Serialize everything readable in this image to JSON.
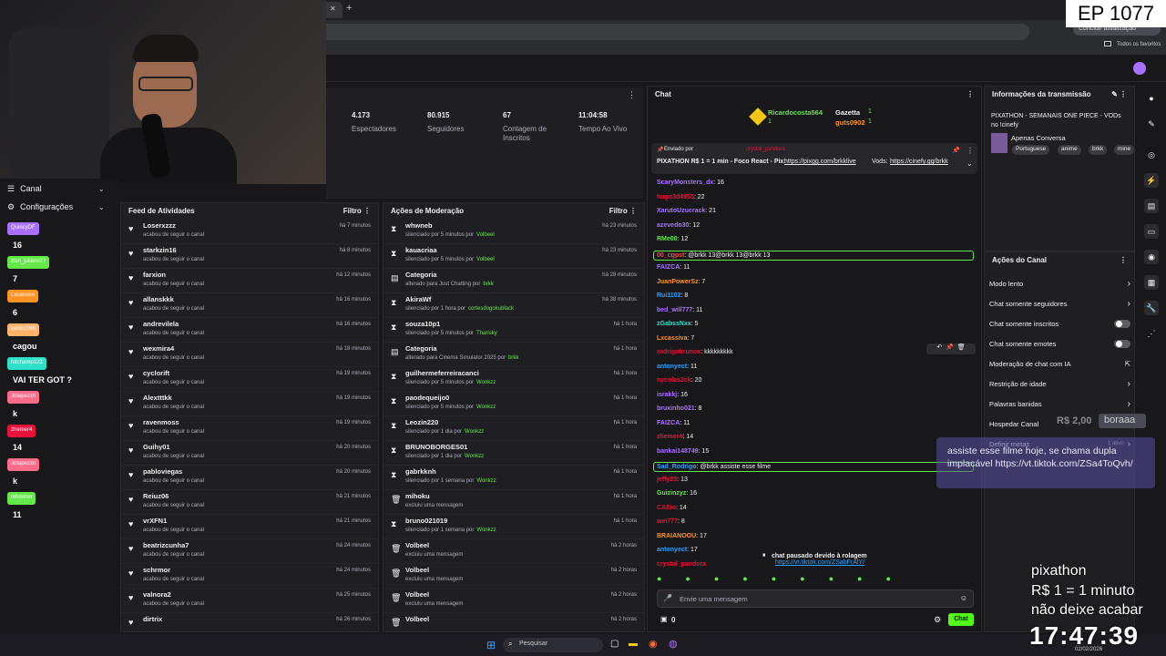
{
  "browser": {
    "add_tab": "+",
    "close_tab": "✕",
    "update_chip": "Concluir atualização",
    "favorites": "Todos os favoritos"
  },
  "ep_badge": "EP 1077",
  "sidebar": {
    "canal": "Canal",
    "configuracoes": "Configurações",
    "viewers": [
      {
        "name": "QuincyDF",
        "value": "16",
        "color": "#a970ff"
      },
      {
        "name": "zion_juliano17",
        "value": "7",
        "color": "#65e84a"
      },
      {
        "name": "Lxcassiva",
        "value": "6",
        "color": "#ff9326"
      },
      {
        "name": "kaiobz069",
        "value": "cagou",
        "color": "#ffb36b"
      },
      {
        "name": "futchamp123",
        "value": "VAI TER GOT ?",
        "color": "#2fe0c8"
      },
      {
        "name": "Jotapezzn",
        "value": "k",
        "color": "#ff6b8b"
      },
      {
        "name": "zhemer4",
        "value": "14",
        "color": "#e8113b"
      },
      {
        "name": "Jotapezzn",
        "value": "k",
        "color": "#ff6b8b"
      },
      {
        "name": "mhmmm",
        "value": "11",
        "color": "#65e84a"
      }
    ]
  },
  "stats": [
    {
      "num": "4.173",
      "label": "Espectadores"
    },
    {
      "num": "80.915",
      "label": "Seguidores"
    },
    {
      "num": "67",
      "label": "Contagem de Inscritos"
    },
    {
      "num": "11:04:58",
      "label": "Tempo Ao Vivo"
    }
  ],
  "feed": {
    "title": "Feed de Atividades",
    "filter": "Filtro",
    "items": [
      {
        "name": "Loserxzzz",
        "desc": "acabou de seguir o canal",
        "time": "há 7 minutos"
      },
      {
        "name": "starkzin16",
        "desc": "acabou de seguir o canal",
        "time": "há 8 minutos"
      },
      {
        "name": "farxion",
        "desc": "acabou de seguir o canal",
        "time": "há 12 minutos"
      },
      {
        "name": "allanskkk",
        "desc": "acabou de seguir o canal",
        "time": "há 16 minutos"
      },
      {
        "name": "andrevilela",
        "desc": "acabou de seguir o canal",
        "time": "há 16 minutos"
      },
      {
        "name": "wexmira4",
        "desc": "acabou de seguir o canal",
        "time": "há 18 minutos"
      },
      {
        "name": "cyclorift",
        "desc": "acabou de seguir o canal",
        "time": "há 19 minutos"
      },
      {
        "name": "Alextttkk",
        "desc": "acabou de seguir o canal",
        "time": "há 19 minutos"
      },
      {
        "name": "ravenmoss",
        "desc": "acabou de seguir o canal",
        "time": "há 19 minutos"
      },
      {
        "name": "Guihy01",
        "desc": "acabou de seguir o canal",
        "time": "há 20 minutos"
      },
      {
        "name": "pabloviegas",
        "desc": "acabou de seguir o canal",
        "time": "há 20 minutos"
      },
      {
        "name": "Reiuz06",
        "desc": "acabou de seguir o canal",
        "time": "há 21 minutos"
      },
      {
        "name": "vrXFN1",
        "desc": "acabou de seguir o canal",
        "time": "há 21 minutos"
      },
      {
        "name": "beatrizcunha7",
        "desc": "acabou de seguir o canal",
        "time": "há 24 minutos"
      },
      {
        "name": "schrmor",
        "desc": "acabou de seguir o canal",
        "time": "há 24 minutos"
      },
      {
        "name": "valnora2",
        "desc": "acabou de seguir o canal",
        "time": "há 25 minutos"
      },
      {
        "name": "dirtrix",
        "desc": "",
        "time": "há 26 minutos"
      }
    ]
  },
  "moderation": {
    "title": "Ações de Moderação",
    "filter": "Filtro",
    "items": [
      {
        "icon": "⧗",
        "name": "whwneb",
        "desc": "silenciado por 5 minutos por",
        "by": "Volbeel",
        "time": "há 23 minutos"
      },
      {
        "icon": "⧗",
        "name": "kauacriaa",
        "desc": "silenciado por 5 minutos por",
        "by": "Volbeel",
        "time": "há 23 minutos"
      },
      {
        "icon": "▤",
        "name": "Categoria",
        "desc": "alterado para Just Chatting por",
        "by": "brkk",
        "time": "há 28 minutos"
      },
      {
        "icon": "⧗",
        "name": "AkiraWf",
        "desc": "silenciado por 1 hora por",
        "by": "cortesdogokublack",
        "time": "há 38 minutos"
      },
      {
        "icon": "⧗",
        "name": "souza10p1",
        "desc": "silenciado por 5 minutos por",
        "by": "Tharisky",
        "time": "há 1 hora"
      },
      {
        "icon": "▤",
        "name": "Categoria",
        "desc": "alterado para Cinema Simulator 2025 por",
        "by": "brkk",
        "time": "há 1 hora"
      },
      {
        "icon": "⧗",
        "name": "guilhermeferreiracanci",
        "desc": "silenciado por 5 minutos por",
        "by": "Wonkzz",
        "time": "há 1 hora"
      },
      {
        "icon": "⧗",
        "name": "paodequeijo0",
        "desc": "silenciado por 5 minutos por",
        "by": "Wonkzz",
        "time": "há 1 hora"
      },
      {
        "icon": "⧗",
        "name": "Leozin220",
        "desc": "silenciado por 1 dia por",
        "by": "Wonkzz",
        "time": "há 1 hora"
      },
      {
        "icon": "⧗",
        "name": "BRUNOBORGES01",
        "desc": "silenciado por 1 dia por",
        "by": "Wonkzz",
        "time": "há 1 hora"
      },
      {
        "icon": "⧗",
        "name": "gabrkknh",
        "desc": "silenciado por 1 semana por",
        "by": "Wonkzz",
        "time": "há 1 hora"
      },
      {
        "icon": "🗑",
        "name": "mihoku",
        "desc": "excluiu uma mensagem",
        "by": "",
        "time": "há 1 hora"
      },
      {
        "icon": "⧗",
        "name": "bruno021019",
        "desc": "silenciado por 1 semana por",
        "by": "Wonkzz",
        "time": "há 1 hora"
      },
      {
        "icon": "🗑",
        "name": "Volbeel",
        "desc": "excluiu uma mensagem",
        "by": "",
        "time": "há 2 horas"
      },
      {
        "icon": "🗑",
        "name": "Volbeel",
        "desc": "excluiu uma mensagem",
        "by": "",
        "time": "há 2 horas"
      },
      {
        "icon": "🗑",
        "name": "Volbeel",
        "desc": "excluiu uma mensagem",
        "by": "",
        "time": "há 2 horas"
      },
      {
        "icon": "🗑",
        "name": "Volbeel",
        "desc": "",
        "by": "",
        "time": "há 2 horas"
      }
    ]
  },
  "chat": {
    "title": "Chat",
    "top_gifters": [
      {
        "name": "Ricardocosta564",
        "count": "1"
      },
      {
        "name": "Gazetta",
        "count": "1"
      },
      {
        "name": "guts0902",
        "count": "1"
      }
    ],
    "pinned_by_label": "Enviado por",
    "pinned_by": "crystal_pandora",
    "pinned_text": "PIXATHON R$ 1 = 1 min - Foco React - Pix:",
    "pinned_link1": "https://pixgg.com/brkklive",
    "pinned_vods": "Vods:",
    "pinned_link2": "https://cinefy.gg/brkk",
    "messages": [
      {
        "user": "ScaryMonsters_dx",
        "color": "#a970ff",
        "text": ": 16"
      },
      {
        "user": "hugo3d4955",
        "color": "#e8113b",
        "text": ": 22"
      },
      {
        "user": "XarutoUzucrack",
        "color": "#a970ff",
        "text": ": 21"
      },
      {
        "user": "azevedo30",
        "color": "#a970ff",
        "text": ": 12"
      },
      {
        "user": "RMe00",
        "color": "#65e84a",
        "text": ": 12"
      },
      {
        "user": "00_cgpst",
        "color": "#ff4444",
        "text": ": @brkk 13@brkk 13@brkk 13"
      },
      {
        "user": "FAIZCA",
        "color": "#a970ff",
        "text": ": 11"
      },
      {
        "user": "JuanPowerSz",
        "color": "#ff9326",
        "text": ": 7"
      },
      {
        "user": "Rui1102",
        "color": "#2fa0ff",
        "text": ": 8"
      },
      {
        "user": "bed_will777",
        "color": "#a970ff",
        "text": ": 11"
      },
      {
        "user": "zGabssNxx",
        "color": "#2fe0c8",
        "text": ": 5"
      },
      {
        "user": "Lxcassiva",
        "color": "#ff9326",
        "text": ": 7"
      },
      {
        "user": "rodrigobrunox",
        "color": "#e8113b",
        "text": ": kkkkkkkkk"
      },
      {
        "user": "antonyect",
        "color": "#2fa0ff",
        "text": ": 11"
      },
      {
        "user": "nycolas2ck",
        "color": "#e8113b",
        "text": ": 20"
      },
      {
        "user": "israkkj",
        "color": "#a970ff",
        "text": ": 16"
      },
      {
        "user": "bruxinho021",
        "color": "#a970ff",
        "text": ": 8"
      },
      {
        "user": "FAIZCA",
        "color": "#a970ff",
        "text": ": 11"
      },
      {
        "user": "zhemer4",
        "color": "#e8113b",
        "text": ": 14"
      },
      {
        "user": "bankai148749",
        "color": "#a970ff",
        "text": ": 15"
      },
      {
        "user": "Sad_Rodrigo",
        "color": "#2fa0ff",
        "text": ": @brkk assiste esse filme"
      },
      {
        "user": "jeffy23",
        "color": "#e8113b",
        "text": ": 13"
      },
      {
        "user": "Guizinzyz",
        "color": "#65e84a",
        "text": ": 16"
      },
      {
        "user": "CAEio",
        "color": "#e8113b",
        "text": ": 14"
      },
      {
        "user": "wei777",
        "color": "#e8113b",
        "text": ": 8"
      },
      {
        "user": "BRAIANOOU",
        "color": "#ff9326",
        "text": ": 17"
      },
      {
        "user": "antonyect",
        "color": "#2fa0ff",
        "text": ": 17"
      },
      {
        "user": "crystal_pandora",
        "color": "#e8113b",
        "text": ""
      }
    ],
    "tiktok_link": "https://vt.tiktok.com/ZSabFrAlY/",
    "paused": "chat pausado devido à rolagem",
    "input_placeholder": "Envie uma mensagem",
    "points": "0",
    "send": "Chat"
  },
  "stream_info": {
    "title": "Informações da transmissão",
    "stream_title": "PIXATHON - SEMANAIS ONE PIECE - VODs no !cinefy",
    "category": "Apenas Conversa",
    "tags": [
      "Portuguese",
      "anime",
      "brkk",
      "mine"
    ]
  },
  "channel_actions": {
    "title": "Ações do Canal",
    "items": [
      {
        "label": "Modo lento",
        "type": "chevron"
      },
      {
        "label": "Chat somente seguidores",
        "type": "chevron"
      },
      {
        "label": "Chat somente inscritos",
        "type": "toggle"
      },
      {
        "label": "Chat somente emotes",
        "type": "toggle"
      },
      {
        "label": "Moderação de chat com IA",
        "type": "link"
      },
      {
        "label": "Restrição de idade",
        "type": "chevron"
      },
      {
        "label": "Palavras banidas",
        "type": "chevron"
      },
      {
        "label": "Hospedar Canal",
        "type": "none"
      },
      {
        "label": "Definir metas",
        "type": "chevron"
      }
    ],
    "metas_badge": "1 ativo"
  },
  "overlay": {
    "donation_amount": "R$ 2,00",
    "donation_user": "boraaa",
    "tts_message": "assiste esse filme hoje, se chama dupla implacável https://vt.tiktok.com/ZSa4ToQvh/",
    "pix_line1": "pixathon",
    "pix_line2": "R$ 1 = 1 minuto",
    "pix_line3": "não deixe acabar",
    "clock": "17:47:39"
  },
  "taskbar": {
    "search": "Pesquisar",
    "date": "02/02/2026"
  }
}
